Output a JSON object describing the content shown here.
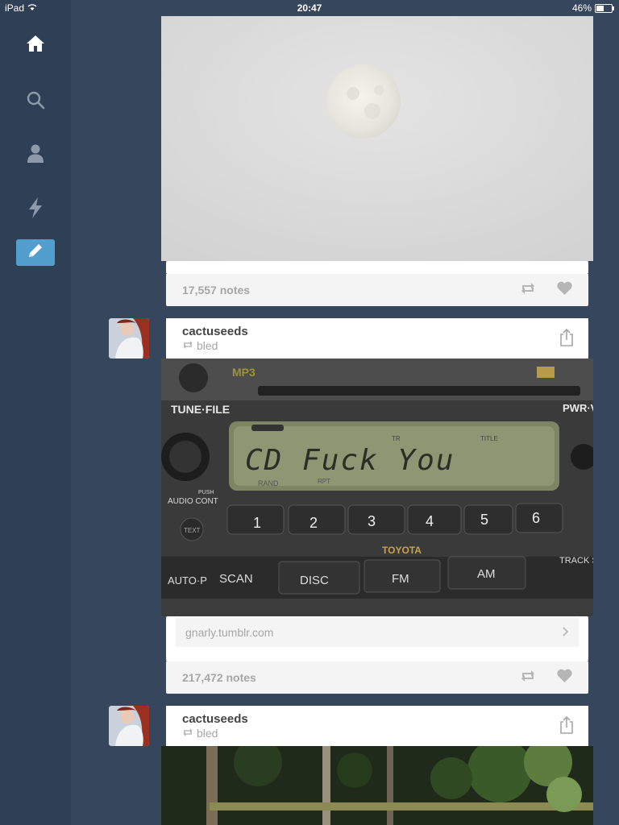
{
  "status_bar": {
    "device": "iPad",
    "time": "20:47",
    "battery": "46%"
  },
  "sidebar": {
    "items": [
      {
        "name": "home",
        "icon": "home-icon"
      },
      {
        "name": "search",
        "icon": "search-icon"
      },
      {
        "name": "account",
        "icon": "user-icon"
      },
      {
        "name": "activity",
        "icon": "lightning-icon"
      },
      {
        "name": "compose",
        "icon": "pencil-icon"
      }
    ],
    "accent": "#529ecc"
  },
  "posts": [
    {
      "notes": "17,557 notes"
    },
    {
      "username": "cactuseeds",
      "reblogged_from": "bled",
      "image": {
        "brand": "TOYOTA",
        "display": "CD Fuck You",
        "labels": [
          "MP3",
          "TUNE·FILE",
          "PWR·V",
          "AUDIO CONT",
          "PUSH",
          "TEXT",
          "AUTO·P",
          "SCAN",
          "DISC",
          "FM",
          "AM",
          "TRACK SEEK",
          "RAND",
          "RPT",
          "TR",
          "TITLE"
        ],
        "preset_buttons": [
          "1",
          "2",
          "3",
          "4",
          "5",
          "6"
        ]
      },
      "source": "gnarly.tumblr.com",
      "notes": "217,472 notes"
    },
    {
      "username": "cactuseeds",
      "reblogged_from": "bled"
    }
  ]
}
